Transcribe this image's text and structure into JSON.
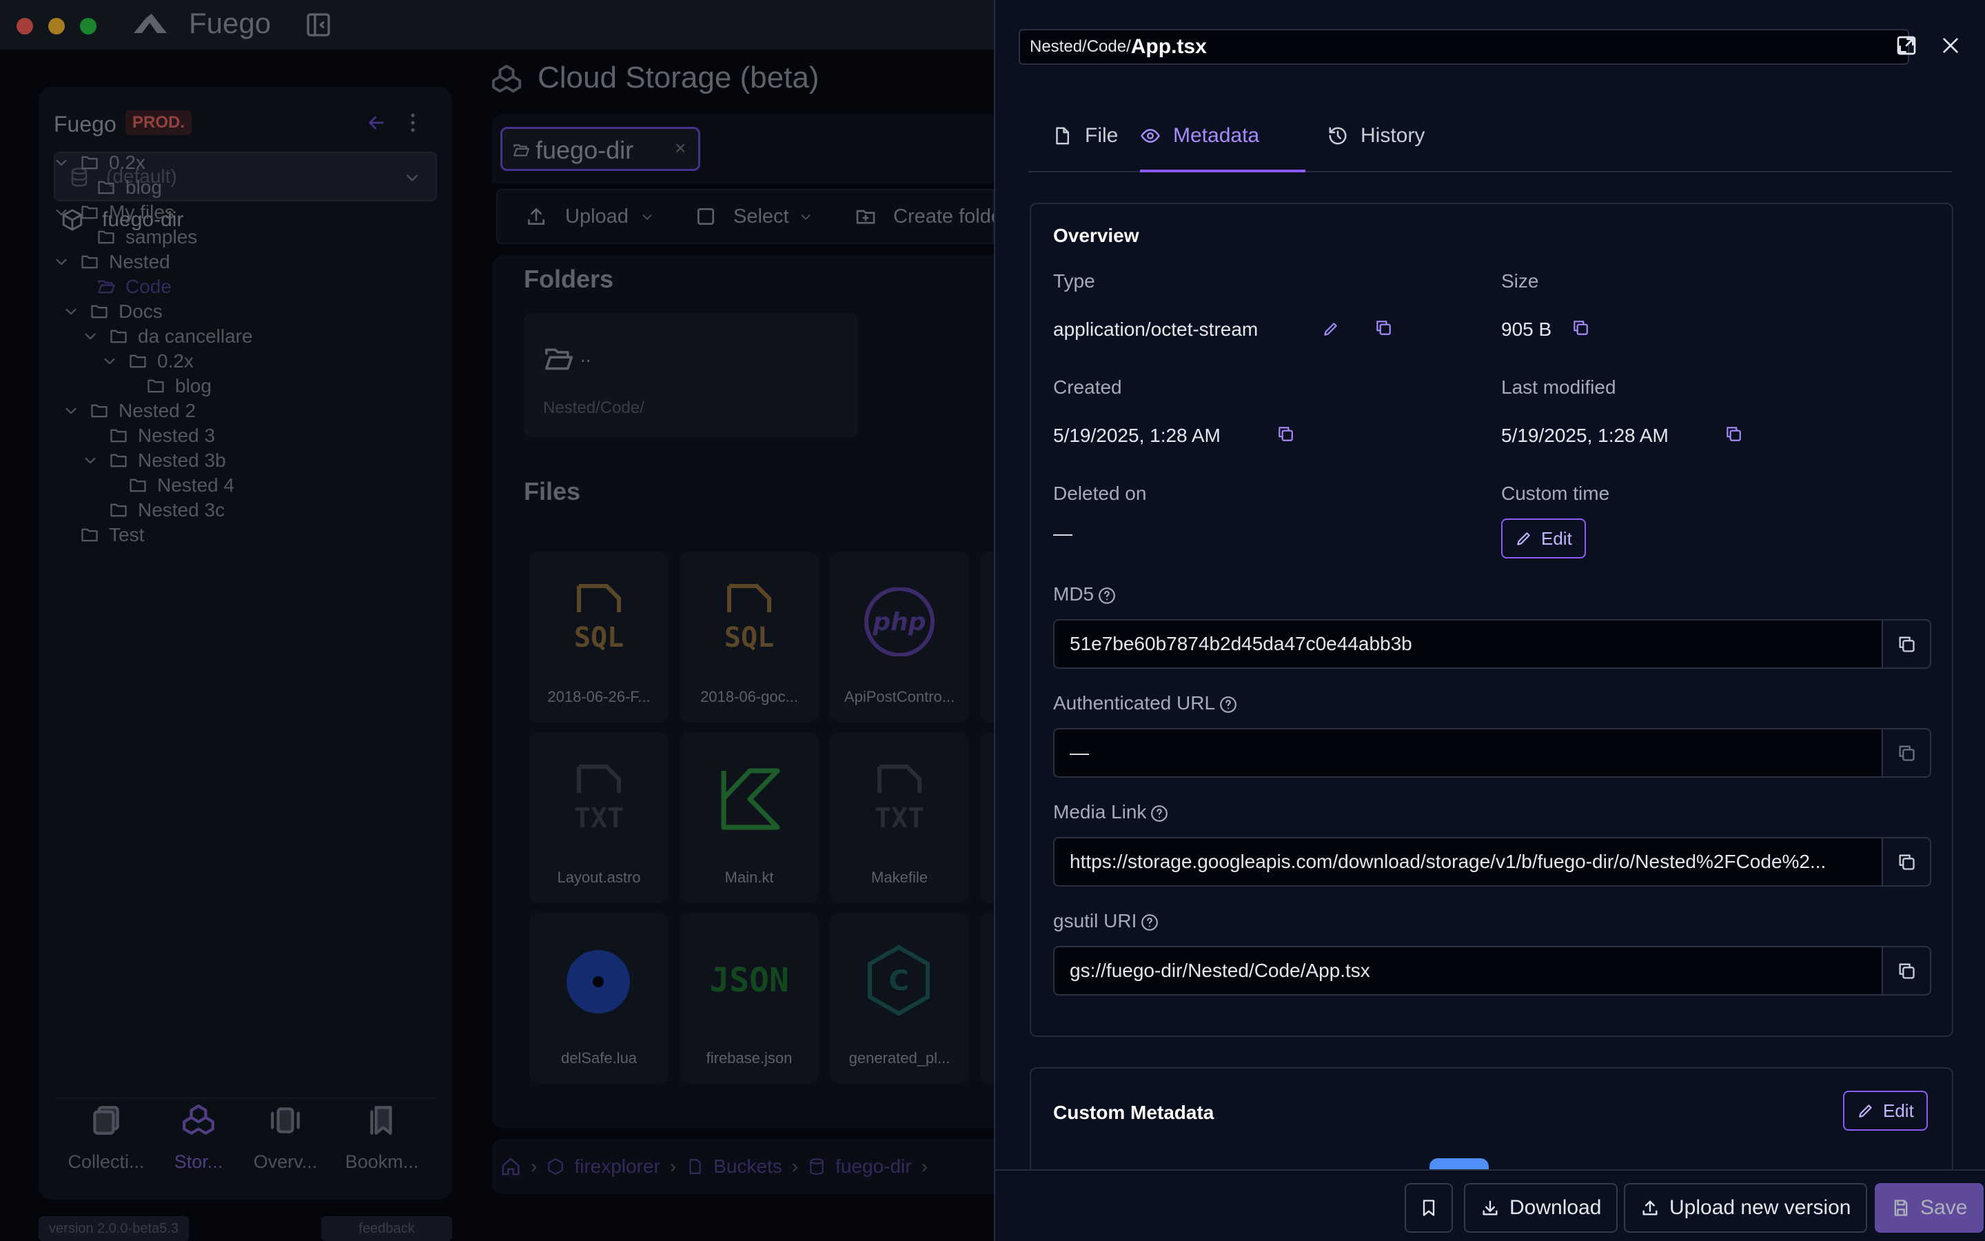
{
  "colors": {
    "accent": "#a78bfa",
    "accent_dark": "#6d4bd0",
    "prod_badge": "#e0625e"
  },
  "app": {
    "name": "Fuego"
  },
  "sidebar": {
    "title": "Fuego",
    "env_badge": "PROD.",
    "db_select": "(default)",
    "bucket": "fuego-dir",
    "tree": [
      {
        "label": "0.2x",
        "expanded": true
      },
      {
        "label": "blog"
      },
      {
        "label": "My files",
        "expanded": true
      },
      {
        "label": "samples"
      },
      {
        "label": "Nested",
        "expanded": true
      },
      {
        "label": "Code",
        "active": true
      },
      {
        "label": "Docs",
        "expanded": true
      },
      {
        "label": "da cancellare",
        "expanded": true
      },
      {
        "label": "0.2x",
        "expanded": true
      },
      {
        "label": "blog"
      },
      {
        "label": "Nested 2",
        "expanded": true
      },
      {
        "label": "Nested 3"
      },
      {
        "label": "Nested 3b",
        "expanded": true
      },
      {
        "label": "Nested 4"
      },
      {
        "label": "Nested 3c"
      },
      {
        "label": "Test"
      }
    ],
    "nav": [
      {
        "label": "Collecti...",
        "icon": "collections-icon"
      },
      {
        "label": "Stor...",
        "icon": "storage-icon",
        "active": true
      },
      {
        "label": "Overv...",
        "icon": "overview-icon"
      },
      {
        "label": "Bookm...",
        "icon": "bookmark-icon"
      }
    ],
    "version": "version 2.0.0-beta5.3",
    "feedback": "feedback"
  },
  "main": {
    "title": "Cloud Storage (beta)",
    "tab_label": "fuego-dir",
    "toolbar": {
      "upload": "Upload",
      "select": "Select",
      "create_folder": "Create folde"
    },
    "folders_heading": "Folders",
    "parent_folder": {
      "label": "..",
      "path": "Nested/Code/"
    },
    "files_heading": "Files",
    "files": [
      {
        "name": "2018-06-26-F...",
        "kind": "SQL"
      },
      {
        "name": "2018-06-goc...",
        "kind": "SQL"
      },
      {
        "name": "ApiPostContro...",
        "kind": "php"
      },
      {
        "name": "Layout.astro",
        "kind": "TXT"
      },
      {
        "name": "Main.kt",
        "kind": "kotlin"
      },
      {
        "name": "Makefile",
        "kind": "TXT"
      },
      {
        "name": "delSafe.lua",
        "kind": "lua"
      },
      {
        "name": "firebase.json",
        "kind": "JSON"
      },
      {
        "name": "generated_pl...",
        "kind": "C"
      }
    ],
    "breadcrumb": [
      "firexplorer",
      "Buckets",
      "fuego-dir"
    ]
  },
  "panel": {
    "path_prefix": "Nested/Code/",
    "file_name": "App.tsx",
    "tabs": [
      "File",
      "Metadata",
      "History"
    ],
    "active_tab": "Metadata",
    "overview": {
      "title": "Overview",
      "type_label": "Type",
      "type_value": "application/octet-stream",
      "size_label": "Size",
      "size_value": "905 B",
      "created_label": "Created",
      "created_value": "5/19/2025, 1:28 AM",
      "modified_label": "Last modified",
      "modified_value": "5/19/2025, 1:28 AM",
      "deleted_label": "Deleted on",
      "deleted_value": "—",
      "custom_time_label": "Custom time",
      "edit_label": "Edit",
      "md5_label": "MD5",
      "md5_value": "51e7be60b7874b2d45da47c0e44abb3b",
      "auth_url_label": "Authenticated URL",
      "auth_url_value": "—",
      "media_link_label": "Media Link",
      "media_link_value": "https://storage.googleapis.com/download/storage/v1/b/fuego-dir/o/Nested%2FCode%2...",
      "gsutil_label": "gsutil URI",
      "gsutil_value": "gs://fuego-dir/Nested/Code/App.tsx"
    },
    "custom_metadata": {
      "title": "Custom Metadata",
      "edit_label": "Edit"
    },
    "footer": {
      "download": "Download",
      "upload_new": "Upload new version",
      "save": "Save"
    }
  }
}
